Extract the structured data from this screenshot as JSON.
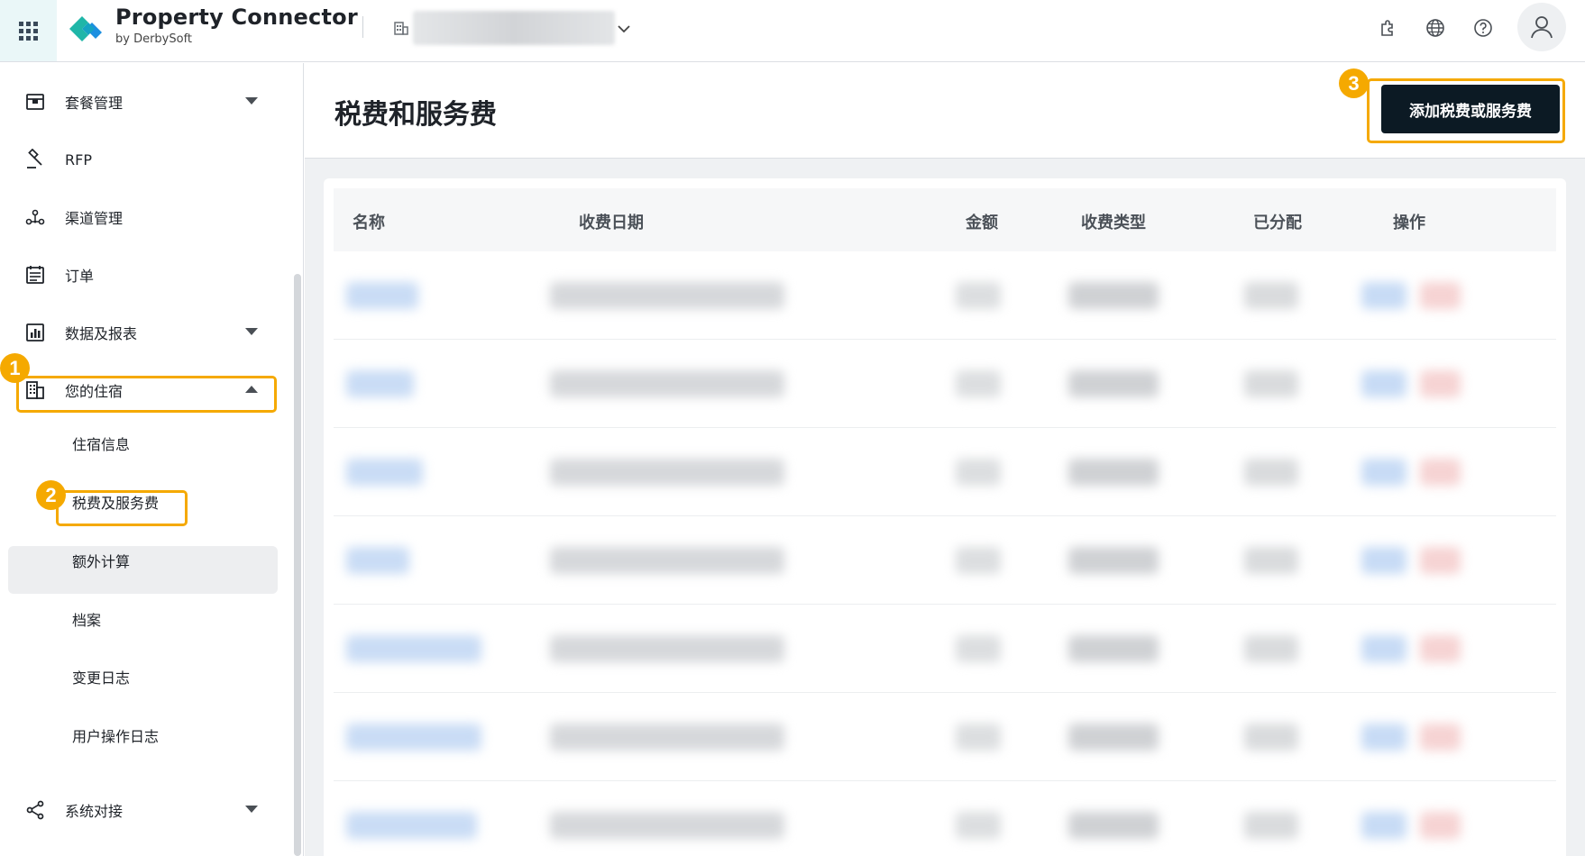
{
  "header": {
    "brand_title": "Property Connector",
    "brand_subtitle": "by DerbySoft",
    "icons": [
      "apps-grid-icon",
      "extension-icon",
      "globe-icon",
      "help-icon",
      "user-icon"
    ]
  },
  "sidebar": {
    "items": [
      {
        "label": "套餐管理",
        "icon": "package-icon",
        "expandable": true,
        "expanded": false
      },
      {
        "label": "RFP",
        "icon": "gavel-icon",
        "expandable": false
      },
      {
        "label": "渠道管理",
        "icon": "channel-icon",
        "expandable": false
      },
      {
        "label": "订单",
        "icon": "order-icon",
        "expandable": false
      },
      {
        "label": "数据及报表",
        "icon": "chart-icon",
        "expandable": true,
        "expanded": false
      },
      {
        "label": "您的住宿",
        "icon": "building-icon",
        "expandable": true,
        "expanded": true
      },
      {
        "label": "系统对接",
        "icon": "share-icon",
        "expandable": true,
        "expanded": false
      }
    ],
    "subitems": [
      {
        "label": "住宿信息"
      },
      {
        "label": "税费及服务费",
        "active": true
      },
      {
        "label": "额外计算"
      },
      {
        "label": "档案"
      },
      {
        "label": "变更日志"
      },
      {
        "label": "用户操作日志"
      }
    ]
  },
  "main": {
    "title": "税费和服务费",
    "add_button": "添加税费或服务费",
    "table": {
      "columns": [
        "名称",
        "收费日期",
        "金额",
        "收费类型",
        "已分配",
        "操作"
      ],
      "rows_obscured": 7
    }
  },
  "annotations": [
    {
      "number": "1",
      "target": "您的住宿"
    },
    {
      "number": "2",
      "target": "税费及服务费"
    },
    {
      "number": "3",
      "target": "添加税费或服务费"
    }
  ],
  "colors": {
    "highlight": "#f5a900",
    "primary_button": "#0c1a24",
    "brand_green": "#1fb6a8",
    "brand_blue": "#1c8fe0"
  }
}
